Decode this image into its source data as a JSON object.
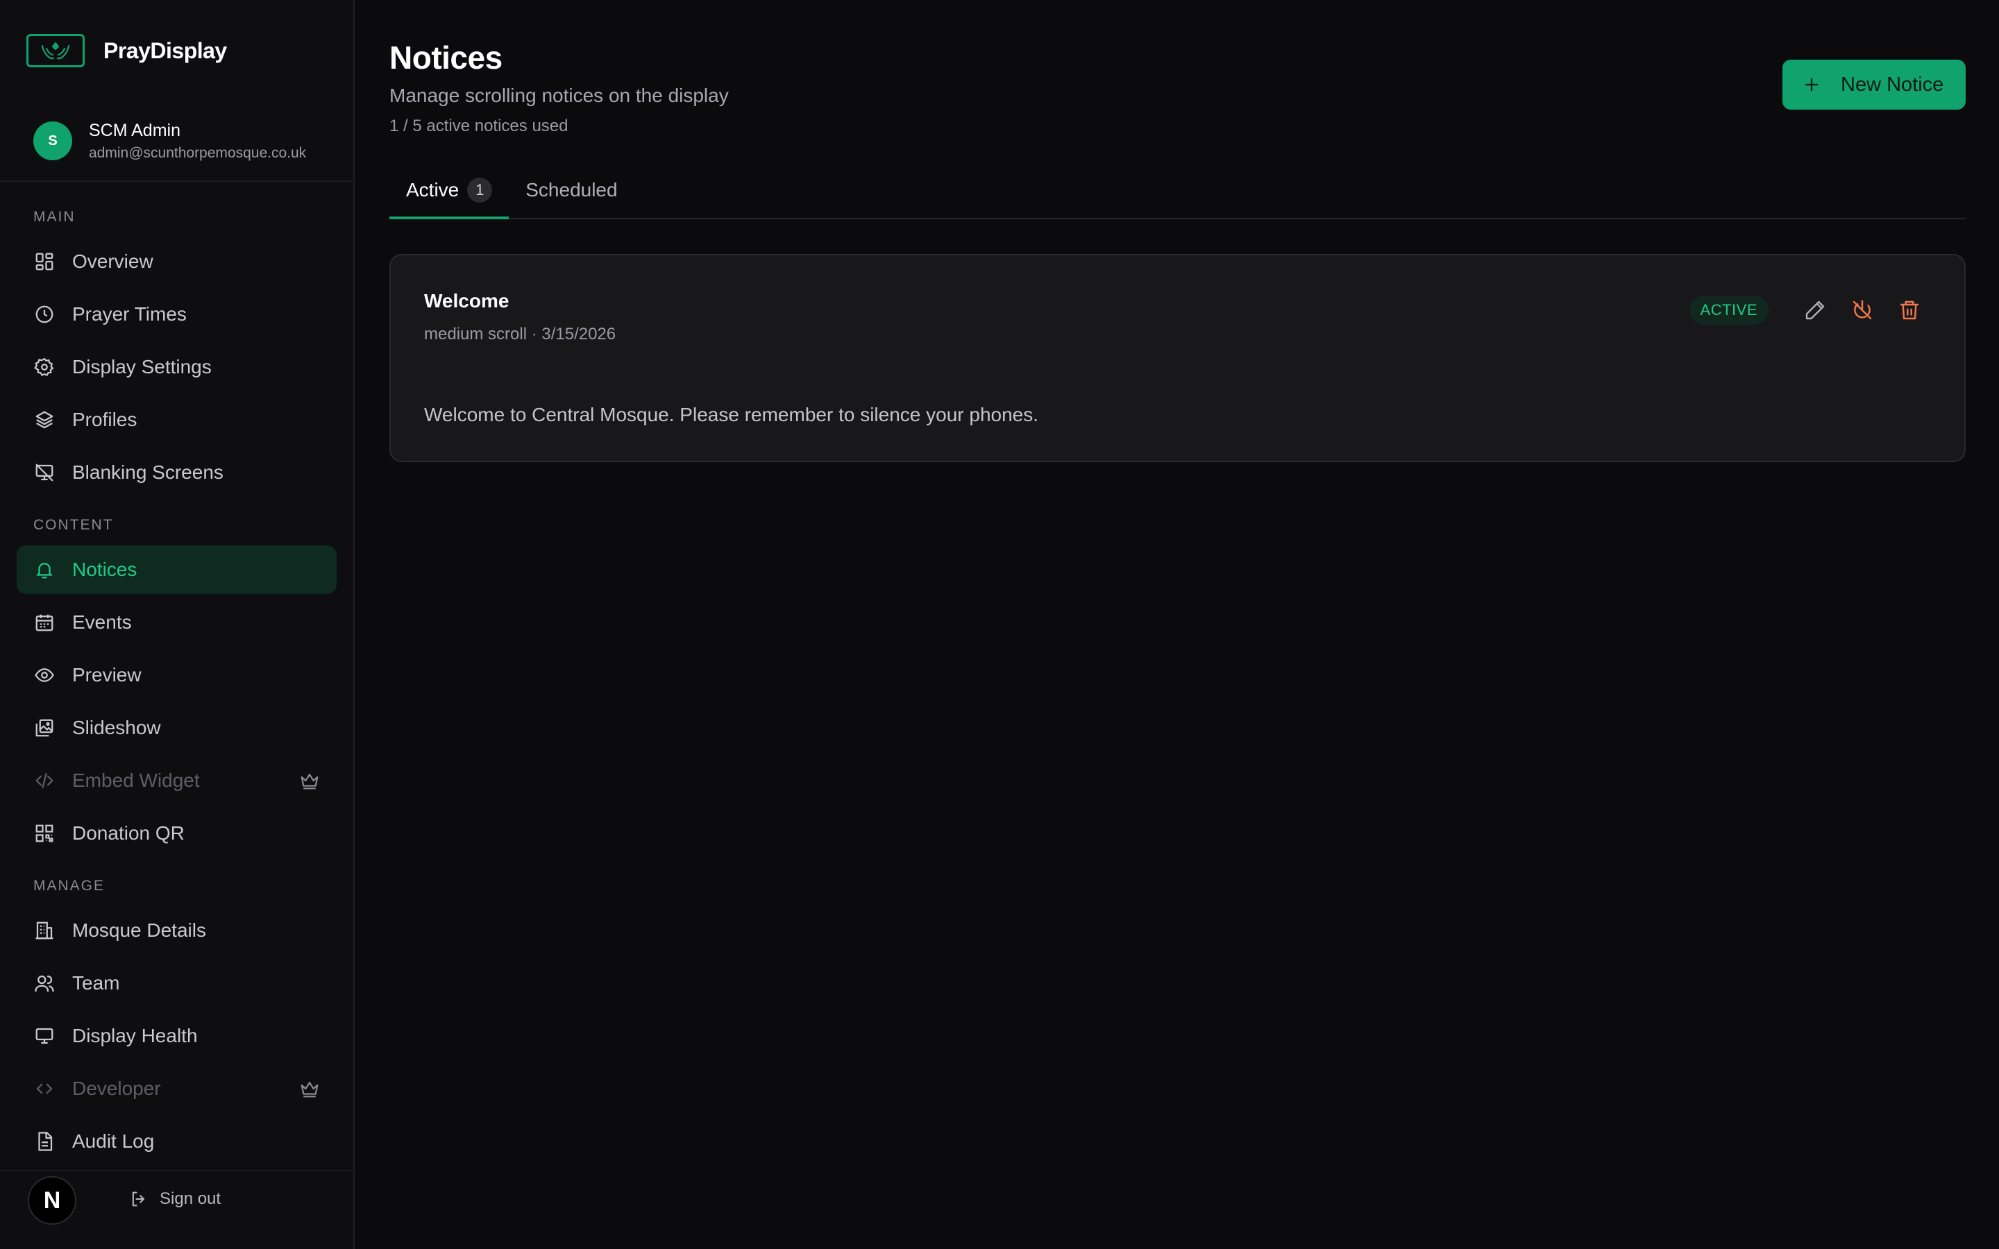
{
  "brand": {
    "name": "PrayDisplay"
  },
  "user": {
    "initial": "S",
    "name": "SCM Admin",
    "email": "admin@scunthorpemosque.co.uk"
  },
  "sidebar": {
    "sections": [
      {
        "label": "MAIN",
        "items": [
          {
            "label": "Overview",
            "icon": "dashboard-icon"
          },
          {
            "label": "Prayer Times",
            "icon": "clock-icon"
          },
          {
            "label": "Display Settings",
            "icon": "gear-icon"
          },
          {
            "label": "Profiles",
            "icon": "layers-icon"
          },
          {
            "label": "Blanking Screens",
            "icon": "monitor-off-icon"
          }
        ]
      },
      {
        "label": "CONTENT",
        "items": [
          {
            "label": "Notices",
            "icon": "bell-icon",
            "active": true
          },
          {
            "label": "Events",
            "icon": "calendar-icon"
          },
          {
            "label": "Preview",
            "icon": "eye-icon"
          },
          {
            "label": "Slideshow",
            "icon": "images-icon"
          },
          {
            "label": "Embed Widget",
            "icon": "code-icon",
            "disabled": true,
            "premium": true
          },
          {
            "label": "Donation QR",
            "icon": "qr-code-icon"
          }
        ]
      },
      {
        "label": "MANAGE",
        "items": [
          {
            "label": "Mosque Details",
            "icon": "building-icon"
          },
          {
            "label": "Team",
            "icon": "users-icon"
          },
          {
            "label": "Display Health",
            "icon": "monitor-icon"
          },
          {
            "label": "Developer",
            "icon": "code-brackets-icon",
            "disabled": true,
            "premium": true
          },
          {
            "label": "Audit Log",
            "icon": "file-text-icon"
          }
        ]
      }
    ],
    "footer": {
      "badge": "N",
      "signout_label": "Sign out"
    }
  },
  "page": {
    "title": "Notices",
    "subtitle": "Manage scrolling notices on the display",
    "usage": "1 / 5 active notices used",
    "new_button_label": "New Notice"
  },
  "tabs": [
    {
      "label": "Active",
      "count": "1",
      "active": true
    },
    {
      "label": "Scheduled",
      "count": null,
      "active": false
    }
  ],
  "notices": [
    {
      "title": "Welcome",
      "meta": "medium scroll · 3/15/2026",
      "status": "ACTIVE",
      "body": "Welcome to Central Mosque. Please remember to silence your phones."
    }
  ],
  "colors": {
    "accent": "#10a36e",
    "accent_text": "#1fc98a",
    "danger": "#f2784b",
    "background": "#0b0b0d",
    "card": "#18181b"
  }
}
